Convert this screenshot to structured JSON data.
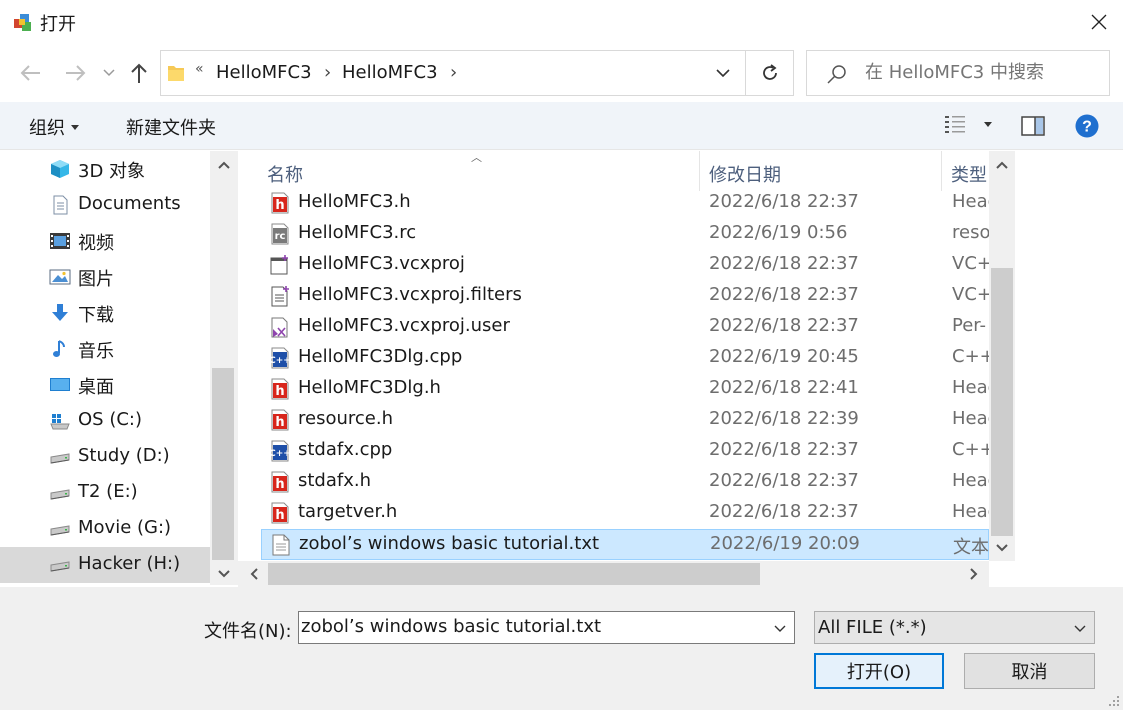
{
  "window": {
    "title": "打开"
  },
  "nav": {
    "breadcrumb_more": "«",
    "crumbs": [
      "HelloMFC3",
      "HelloMFC3"
    ],
    "separator": "›"
  },
  "search": {
    "placeholder": "在 HelloMFC3 中搜索"
  },
  "toolbar": {
    "organize": "组织",
    "new_folder": "新建文件夹"
  },
  "sidebar": {
    "items": [
      {
        "label": "3D 对象",
        "icon": "3d-objects-icon"
      },
      {
        "label": "Documents",
        "icon": "documents-icon"
      },
      {
        "label": "视频",
        "icon": "video-icon"
      },
      {
        "label": "图片",
        "icon": "pictures-icon"
      },
      {
        "label": "下载",
        "icon": "download-icon"
      },
      {
        "label": "音乐",
        "icon": "music-icon"
      },
      {
        "label": "桌面",
        "icon": "desktop-icon"
      },
      {
        "label": "OS (C:)",
        "icon": "windows-drive-icon"
      },
      {
        "label": "Study (D:)",
        "icon": "drive-icon"
      },
      {
        "label": "T2 (E:)",
        "icon": "drive-icon"
      },
      {
        "label": "Movie (G:)",
        "icon": "drive-icon"
      },
      {
        "label": "Hacker (H:)",
        "icon": "drive-icon"
      }
    ],
    "selected_index": 11
  },
  "columns": {
    "name": "名称",
    "date": "修改日期",
    "type": "类型"
  },
  "files": [
    {
      "name": "HelloMFC3.h",
      "date": "2022/6/18 22:37",
      "type": "Head",
      "icon": "header-file-icon"
    },
    {
      "name": "HelloMFC3.rc",
      "date": "2022/6/19 0:56",
      "type": "reso",
      "icon": "rc-file-icon"
    },
    {
      "name": "HelloMFC3.vcxproj",
      "date": "2022/6/18 22:37",
      "type": "VC++",
      "icon": "vcxproj-file-icon"
    },
    {
      "name": "HelloMFC3.vcxproj.filters",
      "date": "2022/6/18 22:37",
      "type": "VC++",
      "icon": "filters-file-icon"
    },
    {
      "name": "HelloMFC3.vcxproj.user",
      "date": "2022/6/18 22:37",
      "type": "Per-",
      "icon": "user-file-icon"
    },
    {
      "name": "HelloMFC3Dlg.cpp",
      "date": "2022/6/19 20:45",
      "type": "C++",
      "icon": "cpp-file-icon"
    },
    {
      "name": "HelloMFC3Dlg.h",
      "date": "2022/6/18 22:41",
      "type": "Head",
      "icon": "header-file-icon"
    },
    {
      "name": "resource.h",
      "date": "2022/6/18 22:39",
      "type": "Head",
      "icon": "header-file-icon"
    },
    {
      "name": "stdafx.cpp",
      "date": "2022/6/18 22:37",
      "type": "C++",
      "icon": "cpp-file-icon"
    },
    {
      "name": "stdafx.h",
      "date": "2022/6/18 22:37",
      "type": "Head",
      "icon": "header-file-icon"
    },
    {
      "name": "targetver.h",
      "date": "2022/6/18 22:37",
      "type": "Head",
      "icon": "header-file-icon"
    },
    {
      "name": "zobol’s windows basic tutorial.txt",
      "date": "2022/6/19 20:09",
      "type": "文本",
      "icon": "text-file-icon"
    }
  ],
  "selected_file_index": 11,
  "bottom": {
    "filename_label": "文件名(N):",
    "filename_value": "zobol’s windows basic tutorial.txt",
    "filter_value": "All FILE (*.*)",
    "open_label": "打开(O)",
    "cancel_label": "取消"
  },
  "colors": {
    "selection": "#cce8ff",
    "accent": "#0078d7",
    "help": "#1f6fcf"
  }
}
